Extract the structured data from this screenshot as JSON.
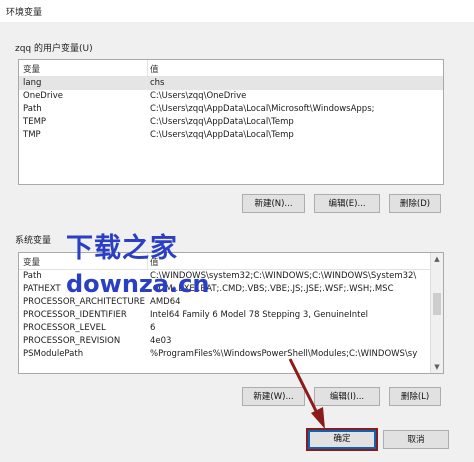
{
  "window": {
    "title": "环境变量"
  },
  "user_section": {
    "label": "zqq 的用户变量(U)",
    "columns": [
      "变量",
      "值"
    ],
    "rows": [
      {
        "name": "lang",
        "value": "chs"
      },
      {
        "name": "OneDrive",
        "value": "C:\\Users\\zqq\\OneDrive"
      },
      {
        "name": "Path",
        "value": "C:\\Users\\zqq\\AppData\\Local\\Microsoft\\WindowsApps;"
      },
      {
        "name": "TEMP",
        "value": "C:\\Users\\zqq\\AppData\\Local\\Temp"
      },
      {
        "name": "TMP",
        "value": "C:\\Users\\zqq\\AppData\\Local\\Temp"
      }
    ],
    "buttons": {
      "new": "新建(N)...",
      "edit": "编辑(E)...",
      "delete": "删除(D)"
    }
  },
  "system_section": {
    "label": "系统变量",
    "columns": [
      "变量",
      "值"
    ],
    "rows": [
      {
        "name": "Path",
        "value": "C:\\WINDOWS\\system32;C:\\WINDOWS;C:\\WINDOWS\\System32\\"
      },
      {
        "name": "PATHEXT",
        "value": ".COM;.EXE;.BAT;.CMD;.VBS;.VBE;.JS;.JSE;.WSF;.WSH;.MSC"
      },
      {
        "name": "PROCESSOR_ARCHITECTURE",
        "value": "AMD64"
      },
      {
        "name": "PROCESSOR_IDENTIFIER",
        "value": "Intel64 Family 6 Model 78 Stepping 3, GenuineIntel"
      },
      {
        "name": "PROCESSOR_LEVEL",
        "value": "6"
      },
      {
        "name": "PROCESSOR_REVISION",
        "value": "4e03"
      },
      {
        "name": "PSModulePath",
        "value": "%ProgramFiles%\\WindowsPowerShell\\Modules;C:\\WINDOWS\\sy"
      }
    ],
    "buttons": {
      "new": "新建(W)...",
      "edit": "编辑(I)...",
      "delete": "删除(L)"
    }
  },
  "footer": {
    "ok": "确定",
    "cancel": "取消"
  },
  "watermark": {
    "line1": "下载之家",
    "line2": "downza.cn"
  },
  "colors": {
    "highlight": "#8b1a1a",
    "watermark": "#2a3fc4",
    "primary_border": "#0a64b4"
  }
}
